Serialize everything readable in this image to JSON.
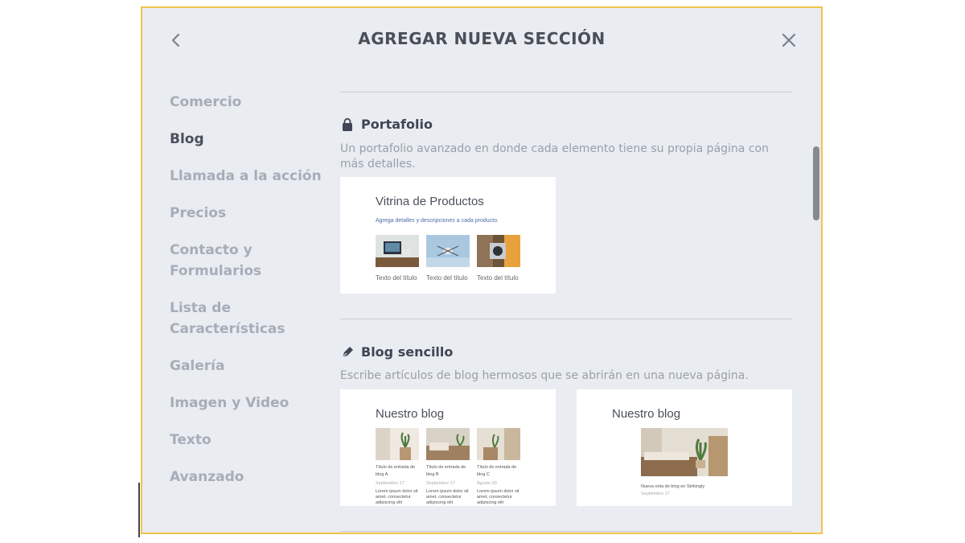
{
  "header": {
    "title": "AGREGAR NUEVA SECCIÓN"
  },
  "sidebar": {
    "items": [
      {
        "label": "Comercio",
        "active": false
      },
      {
        "label": "Blog",
        "active": true
      },
      {
        "label": "Llamada a la acción",
        "active": false
      },
      {
        "label": "Precios",
        "active": false
      },
      {
        "label": "Contacto y Formularios",
        "active": false
      },
      {
        "label": "Lista de Características",
        "active": false
      },
      {
        "label": "Galería",
        "active": false
      },
      {
        "label": "Imagen y Video",
        "active": false
      },
      {
        "label": "Texto",
        "active": false
      },
      {
        "label": "Avanzado",
        "active": false
      }
    ]
  },
  "sections": {
    "portfolio": {
      "icon": "lock-icon",
      "title": "Portafolio",
      "description": "Un portafolio avanzado en donde cada elemento tiene su propia página con más detalles.",
      "card": {
        "title": "Vitrina de Productos",
        "subtitle": "Agrega detalles y descripciones a cada producto.",
        "items": [
          {
            "caption": "Texto del título",
            "image": "tv-stand-image"
          },
          {
            "caption": "Texto del título",
            "image": "drone-image"
          },
          {
            "caption": "Texto del título",
            "image": "camera-image"
          }
        ]
      }
    },
    "simple_blog": {
      "icon": "pen-icon",
      "title": "Blog sencillo",
      "description": "Escribe artículos de blog hermosos que se abrirán en una nueva página.",
      "cards": [
        {
          "title": "Nuestro blog",
          "posts": [
            {
              "title_line1": "Título de entrada de",
              "title_line2": "blog A",
              "date": "Septiembre 17",
              "excerpt1": "Lorem ipsum dolor sit",
              "excerpt2": "amet, consectetur",
              "excerpt3": "adipiscing elit"
            },
            {
              "title_line1": "Título de entrada de",
              "title_line2": "blog B",
              "date": "Septiembre 17",
              "excerpt1": "Lorem ipsum dolor sit",
              "excerpt2": "amet, consectetur",
              "excerpt3": "adipiscing elit"
            },
            {
              "title_line1": "Título de entrada de",
              "title_line2": "blog C",
              "date": "Agosto 30",
              "excerpt1": "Lorem ipsum dolor sit",
              "excerpt2": "amet, consectetur",
              "excerpt3": "adipiscing elit"
            }
          ]
        },
        {
          "title": "Nuestro blog",
          "feature_caption": "Nueva nota de blog en Strikingly",
          "feature_date": "Septiembre 17"
        }
      ]
    }
  },
  "colors": {
    "accent_border": "#f0c34a",
    "modal_bg": "#e9ecf1",
    "sidebar_active": "#4a4f5a",
    "sidebar_inactive": "#a7adb8"
  }
}
